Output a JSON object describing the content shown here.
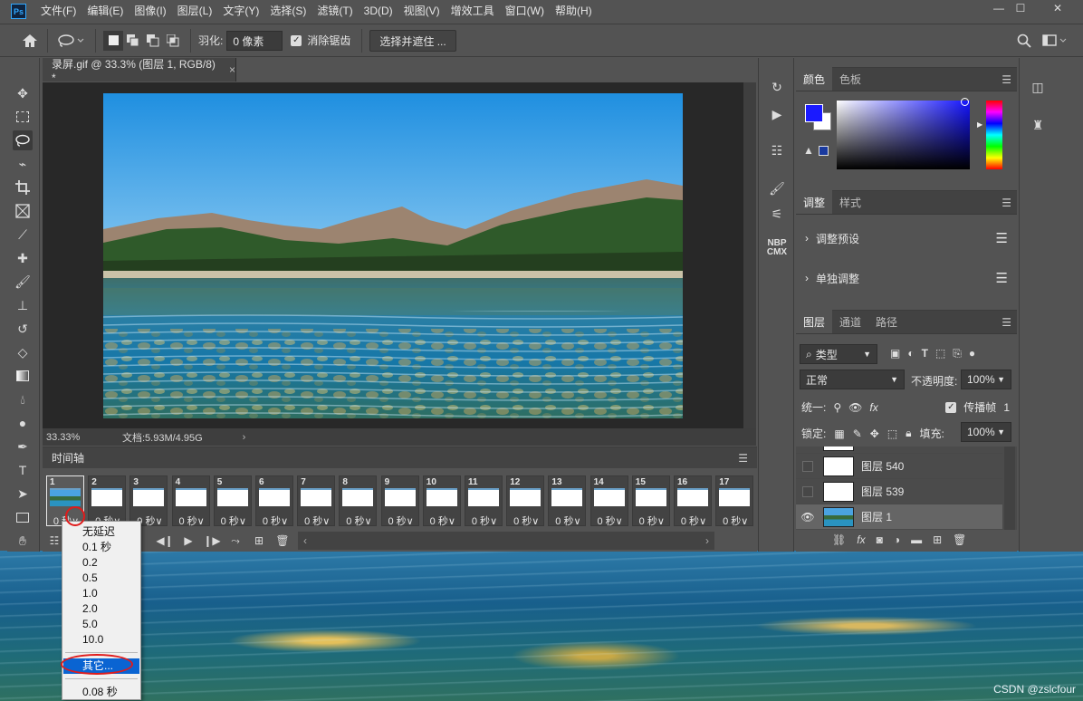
{
  "app": {
    "logo": "Ps",
    "menus": [
      "文件(F)",
      "编辑(E)",
      "图像(I)",
      "图层(L)",
      "文字(Y)",
      "选择(S)",
      "滤镜(T)",
      "3D(D)",
      "视图(V)",
      "增效工具",
      "窗口(W)",
      "帮助(H)"
    ],
    "window_controls": [
      "—",
      "☐",
      "✕"
    ]
  },
  "options_bar": {
    "feather_label": "羽化:",
    "feather_value": "0 像素",
    "antialias_label": "消除锯齿",
    "select_mask_button": "选择并遮住 ..."
  },
  "document": {
    "tab_title": "录屏.gif @ 33.3% (图层 1, RGB/8) *",
    "zoom": "33.33%",
    "doc_size": "文档:5.93M/4.95G"
  },
  "timeline": {
    "title": "时间轴",
    "frames": [
      {
        "num": "1",
        "delay": "0 秒"
      },
      {
        "num": "2",
        "delay": "0 秒"
      },
      {
        "num": "3",
        "delay": "0 秒"
      },
      {
        "num": "4",
        "delay": "0 秒"
      },
      {
        "num": "5",
        "delay": "0 秒"
      },
      {
        "num": "6",
        "delay": "0 秒"
      },
      {
        "num": "7",
        "delay": "0 秒"
      },
      {
        "num": "8",
        "delay": "0 秒"
      },
      {
        "num": "9",
        "delay": "0 秒"
      },
      {
        "num": "10",
        "delay": "0 秒"
      },
      {
        "num": "11",
        "delay": "0 秒"
      },
      {
        "num": "12",
        "delay": "0 秒"
      },
      {
        "num": "13",
        "delay": "0 秒"
      },
      {
        "num": "14",
        "delay": "0 秒"
      },
      {
        "num": "15",
        "delay": "0 秒"
      },
      {
        "num": "16",
        "delay": "0 秒"
      },
      {
        "num": "17",
        "delay": "0 秒"
      }
    ]
  },
  "delay_menu": {
    "items": [
      "无延迟",
      "0.1 秒",
      "0.2",
      "0.5",
      "1.0",
      "2.0",
      "5.0",
      "10.0"
    ],
    "other": "其它...",
    "current": "0.08 秒"
  },
  "color_panel": {
    "tabs": [
      "颜色",
      "色板"
    ],
    "foreground": "#1a1aff",
    "background": "#ffffff"
  },
  "adjust_panel": {
    "tabs": [
      "调整",
      "样式"
    ],
    "rows": [
      "调整预设",
      "单独调整"
    ]
  },
  "layers_panel": {
    "tabs": [
      "图层",
      "通道",
      "路径"
    ],
    "filter": "类型",
    "blend_mode": "正常",
    "opacity_label": "不透明度:",
    "opacity_value": "100%",
    "unify_label": "统一:",
    "propagate_label": "传播帧",
    "propagate_value": "1",
    "lock_label": "锁定:",
    "fill_label": "填充:",
    "fill_value": "100%",
    "layers": [
      {
        "name": "图层 540",
        "visible": false
      },
      {
        "name": "图层 539",
        "visible": false
      },
      {
        "name": "图层 1",
        "visible": true
      }
    ]
  },
  "watermark": "CSDN @zslcfour"
}
